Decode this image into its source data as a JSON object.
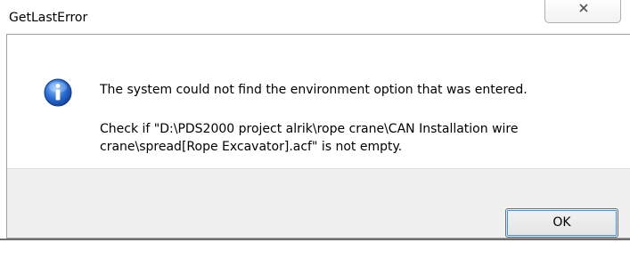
{
  "dialog": {
    "title": "GetLastError",
    "close_glyph": "close-icon",
    "icon": "info-icon",
    "message": "The system could not find the environment option that was entered.",
    "detail_line1": "Check if \"D:\\PDS2000 project alrik\\rope crane\\CAN Installation wire",
    "detail_line2": "crane\\spread[Rope Excavator].acf\" is not empty.",
    "ok_label": "OK"
  },
  "colors": {
    "footer_bg": "#f0f0f0",
    "info_blue": "#1f5fbf",
    "border": "#a0a0a0"
  }
}
